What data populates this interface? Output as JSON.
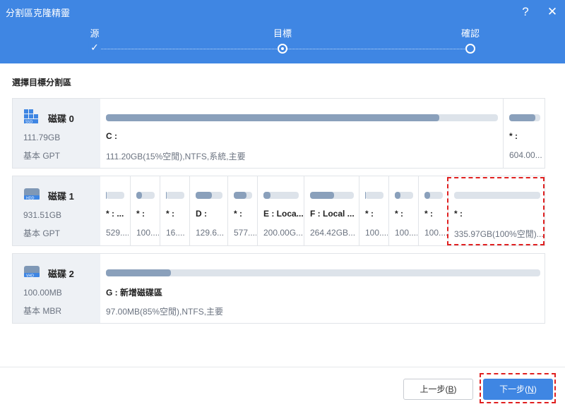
{
  "window": {
    "title": "分割區克隆精靈",
    "help": "?",
    "close": "✕"
  },
  "steps": [
    {
      "label": "源",
      "state": "done"
    },
    {
      "label": "目標",
      "state": "current"
    },
    {
      "label": "確認",
      "state": "future"
    }
  ],
  "section_title": "選擇目標分割區",
  "disks": [
    {
      "name": "磁碟 0",
      "icon": "ssd-disk-icon",
      "size": "111.79GB",
      "type": "基本 GPT",
      "partitions": [
        {
          "label": "C :",
          "info": "111.20GB(15%空閒),NTFS,系統,主要",
          "used": 0.85
        },
        {
          "label": "* :",
          "info": "604.00...",
          "used": 0.85
        }
      ]
    },
    {
      "name": "磁碟 1",
      "icon": "hdd-disk-icon",
      "size": "931.51GB",
      "type": "基本 GPT",
      "partitions": [
        {
          "label": "* : ...",
          "info": "529....",
          "used": 0.05
        },
        {
          "label": "* :",
          "info": "100....",
          "used": 0.3
        },
        {
          "label": "* :",
          "info": "16....",
          "used": 0.05
        },
        {
          "label": "D :",
          "info": "129.6...",
          "used": 0.6
        },
        {
          "label": "* :",
          "info": "577....",
          "used": 0.7
        },
        {
          "label": "E : Loca...",
          "info": "200.00G...",
          "used": 0.2
        },
        {
          "label": "F : Local ...",
          "info": "264.42GB...",
          "used": 0.55
        },
        {
          "label": "* :",
          "info": "100....",
          "used": 0.05
        },
        {
          "label": "* :",
          "info": "100....",
          "used": 0.3
        },
        {
          "label": "* :",
          "info": "100....",
          "used": 0.3
        },
        {
          "label": "* :",
          "info": "335.97GB(100%空閒)...",
          "used": 0.0,
          "selected": true
        }
      ]
    },
    {
      "name": "磁碟 2",
      "icon": "vhd-disk-icon",
      "size": "100.00MB",
      "type": "基本 MBR",
      "partitions": [
        {
          "label": "G : 新增磁碟區",
          "info": "97.00MB(85%空閒),NTFS,主要",
          "used": 0.15
        }
      ]
    }
  ],
  "buttons": {
    "prev": "上一步(B)",
    "prev_main": "上一步(",
    "prev_key": "B",
    "next_main": "下一步(",
    "next_key": "N",
    "close_paren": ")"
  },
  "colors": {
    "accent": "#3f86e3",
    "bar_fill": "#8aa0bb",
    "bar_track": "#dde3ea",
    "highlight": "#e02020"
  }
}
